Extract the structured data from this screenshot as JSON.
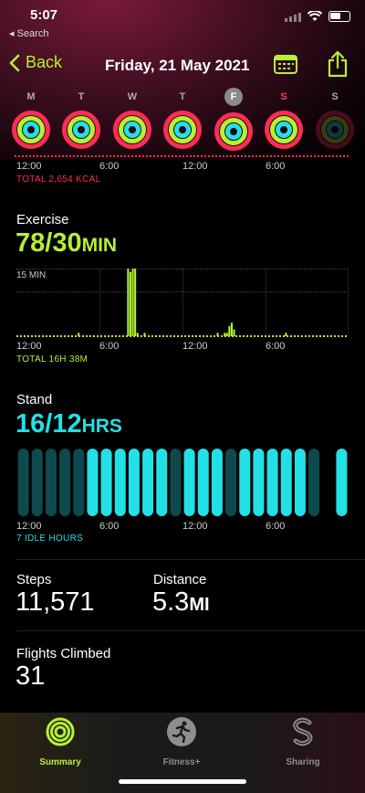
{
  "status": {
    "time": "5:07",
    "back_app": "◂ Search"
  },
  "nav": {
    "back_label": "Back",
    "title": "Friday, 21 May 2021"
  },
  "week": [
    {
      "letter": "M",
      "state": "normal"
    },
    {
      "letter": "T",
      "state": "normal"
    },
    {
      "letter": "W",
      "state": "normal"
    },
    {
      "letter": "T",
      "state": "normal"
    },
    {
      "letter": "F",
      "state": "selected"
    },
    {
      "letter": "S",
      "state": "today"
    },
    {
      "letter": "S",
      "state": "future"
    }
  ],
  "axis_labels": [
    "12:00",
    "6:00",
    "12:00",
    "6:00"
  ],
  "move": {
    "total": "TOTAL 2,654 KCAL"
  },
  "exercise": {
    "label": "Exercise",
    "value": "78/30",
    "unit": "MIN",
    "scale_label": "15 MIN",
    "total": "TOTAL 16H 38M",
    "bars": [
      0.5,
      0.5,
      0.5,
      0.5,
      0.5,
      0.5,
      0.5,
      0.5,
      0.5,
      0.5,
      0.5,
      0.5,
      0.5,
      0.5,
      0.5,
      0.5,
      0.5,
      0.5,
      0.5,
      0.5,
      0.5,
      0.5,
      0.5,
      0.5,
      0.5,
      0.5,
      1,
      0.5,
      0.5,
      0.5,
      0.5,
      0.5,
      0.5,
      0.5,
      0.5,
      0.5,
      0.5,
      0.5,
      0.5,
      0.5,
      0.5,
      0.5,
      0.5,
      0.5,
      0.5,
      0.5,
      0.5,
      20,
      19,
      20,
      20,
      1,
      0.5,
      0.5,
      1,
      0.5,
      0.5,
      0.5,
      0.5,
      0.5,
      0.5,
      0.5,
      0.5,
      0.5,
      0.5,
      0.5,
      0.5,
      0.5,
      0.5,
      0.5,
      0.5,
      0.5,
      0.5,
      0.5,
      0.5,
      0.5,
      0.5,
      0.5,
      0.5,
      0.5,
      0.5,
      0.5,
      0.5,
      0.5,
      0.5,
      1,
      0.5,
      0.5,
      1,
      1,
      3,
      4,
      2,
      0.5,
      0.5,
      0.5,
      0.5,
      0.5,
      0.5,
      0.5,
      0.5,
      0.5,
      0.5,
      0.5,
      0.5,
      0.5,
      0.5,
      0.5,
      0.5,
      0.5,
      0.5,
      0.5,
      0.5,
      0.5,
      1,
      0.5,
      0.5,
      0.5,
      0.5,
      0.5,
      0.5,
      0.5,
      0.5,
      0.5,
      0.5,
      0.5,
      0.5,
      0.5,
      0.5,
      0.5,
      0.5,
      0.5,
      0.5,
      0.5,
      0.5,
      0.5,
      0.5,
      0.5,
      0.5,
      0.5,
      0.5
    ]
  },
  "stand": {
    "label": "Stand",
    "value": "16/12",
    "unit": "HRS",
    "idle": "7 IDLE HOURS",
    "hours": [
      0,
      0,
      0,
      0,
      0,
      1,
      1,
      1,
      1,
      1,
      1,
      0,
      1,
      1,
      1,
      0,
      1,
      1,
      1,
      1,
      1,
      0,
      2,
      1
    ]
  },
  "steps": {
    "label": "Steps",
    "value": "11,571"
  },
  "distance": {
    "label": "Distance",
    "value": "5.3",
    "unit": "MI"
  },
  "flights": {
    "label": "Flights Climbed",
    "value": "31"
  },
  "tabs": [
    {
      "label": "Summary",
      "icon": "activity-rings-icon",
      "active": true
    },
    {
      "label": "Fitness+",
      "icon": "fitness-runner-icon",
      "active": false
    },
    {
      "label": "Sharing",
      "icon": "sharing-icon",
      "active": false
    }
  ],
  "colors": {
    "move": "#ff2d55",
    "exercise": "#b5f033",
    "stand": "#23e0e6",
    "stand_idle": "#0e4a4d"
  }
}
